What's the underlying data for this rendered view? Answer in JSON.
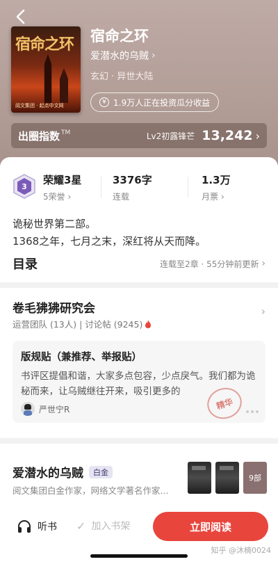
{
  "header": {
    "book_title": "宿命之环",
    "author": "爱潜水的乌贼",
    "genre": "玄幻 · 异世大陆",
    "invest_text": "1.9万人正在投资瓜分收益",
    "cover_title": "宿命之环",
    "cover_footer": "阅文集团 · 起点中文网"
  },
  "index": {
    "label": "出圈指数",
    "tm": "TM",
    "level": "Lv2初露锋芒",
    "value": "13,242"
  },
  "stats": {
    "honor_title": "荣耀3星",
    "honor_sub": "5荣誉",
    "badge_number": "3",
    "words_main": "3376字",
    "words_sub": "连载",
    "tickets_main": "1.3万",
    "tickets_sub": "月票"
  },
  "intro": {
    "line1": "诡秘世界第二部。",
    "line2": "1368之年，七月之末，深红将从天而降。"
  },
  "toc": {
    "label": "目录",
    "status": "连载至2章 · 55分钟前更新"
  },
  "circle": {
    "title": "卷毛狒狒研究会",
    "meta": "运营团队 (13人) | 讨论帖 (9245)",
    "post_title": "版规贴（兼推荐、举报贴）",
    "post_body": "书评区提倡和谐，大家多点包容，少点戾气。我们都为诡秘而来，让乌贼继往开来，吸引更多的",
    "post_user": "严世宁R",
    "stamp_text": "精华"
  },
  "author_section": {
    "name": "爱潜水的乌贼",
    "tier": "白金",
    "desc": "阅文集团白金作家，网络文学著名作家...",
    "works_count": "9部"
  },
  "bottom": {
    "listen": "听书",
    "add_shelf": "加入书架",
    "read": "立即阅读",
    "watermark": "知乎 @沐楠0024"
  }
}
